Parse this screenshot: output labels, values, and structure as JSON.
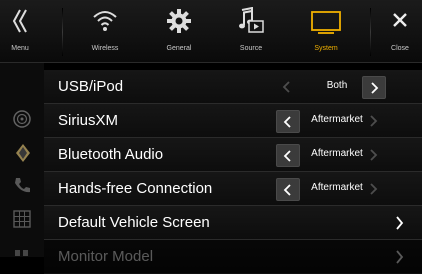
{
  "topbar": {
    "menu_label": "Menu",
    "tabs": [
      {
        "label": "Wireless",
        "icon": "wireless-icon"
      },
      {
        "label": "General",
        "icon": "gear-icon"
      },
      {
        "label": "Source",
        "icon": "music-source-icon"
      },
      {
        "label": "System",
        "icon": "monitor-icon"
      }
    ],
    "close_label": "Close",
    "accent_color": "#f0b000"
  },
  "settings": [
    {
      "label": "USB/iPod",
      "value": "Both"
    },
    {
      "label": "SiriusXM",
      "value": "Aftermarket"
    },
    {
      "label": "Bluetooth Audio",
      "value": "Aftermarket"
    },
    {
      "label": "Hands-free Connection",
      "value": "Aftermarket"
    },
    {
      "label": "Default Vehicle Screen"
    },
    {
      "label": "Monitor Model"
    }
  ]
}
